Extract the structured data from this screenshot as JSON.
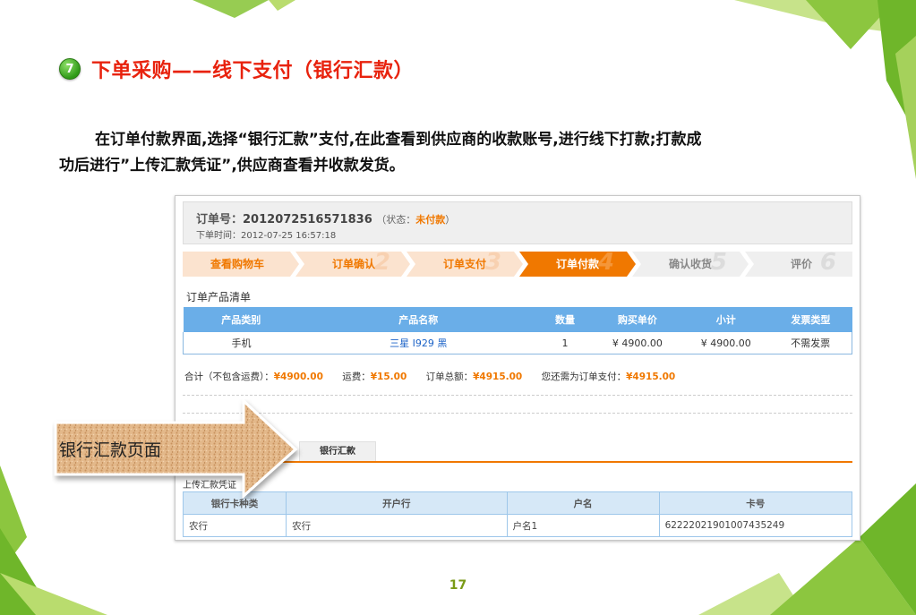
{
  "slide": {
    "step_number": "7",
    "title": "下单采购——线下支付（银行汇款）",
    "description_line1": "在订单付款界面,选择“银行汇款”支付,在此查看到供应商的收款账号,进行线下打款;打款成",
    "description_line2": "功后进行”上传汇款凭证”,供应商查看并收款发货。",
    "page_number": "17",
    "callout_label": "银行汇款页面",
    "accent_green": "#8cc63f",
    "title_color": "#e8220d"
  },
  "order": {
    "number_label": "订单号：",
    "number": "2012072516571836",
    "status_prefix": "（状态：",
    "status": "未付款",
    "status_suffix": "）",
    "time_label": "下单时间：",
    "time": "2012-07-25 16:57:18"
  },
  "steps": [
    {
      "label": "查看购物车",
      "wm": ""
    },
    {
      "label": "订单确认",
      "wm": "2"
    },
    {
      "label": "订单支付",
      "wm": "3"
    },
    {
      "label": "订单付款",
      "wm": "4"
    },
    {
      "label": "确认收货",
      "wm": "5"
    },
    {
      "label": "评价",
      "wm": "6"
    }
  ],
  "products": {
    "section_title": "订单产品清单",
    "headers": [
      "产品类别",
      "产品名称",
      "数量",
      "购买单价",
      "小计",
      "发票类型"
    ],
    "rows": [
      [
        "手机",
        "三星 I929 黑",
        "1",
        "¥ 4900.00",
        "¥ 4900.00",
        "不需发票"
      ]
    ]
  },
  "totals": {
    "subtotal_label": "合计（不包含运费）：",
    "subtotal": "¥4900.00",
    "shipping_label": "运费：",
    "shipping": "¥15.00",
    "order_total_label": "订单总额：",
    "order_total": "¥4915.00",
    "due_label": "您还需为订单支付：",
    "due": "¥4915.00"
  },
  "payment": {
    "tab_label": "银行汇款",
    "upload_label": "上传汇款凭证",
    "bank_headers": [
      "银行卡种类",
      "开户行",
      "户名",
      "卡号"
    ],
    "bank_rows": [
      [
        "农行",
        "农行",
        "户名1",
        "6222202190100743524​9"
      ]
    ]
  }
}
